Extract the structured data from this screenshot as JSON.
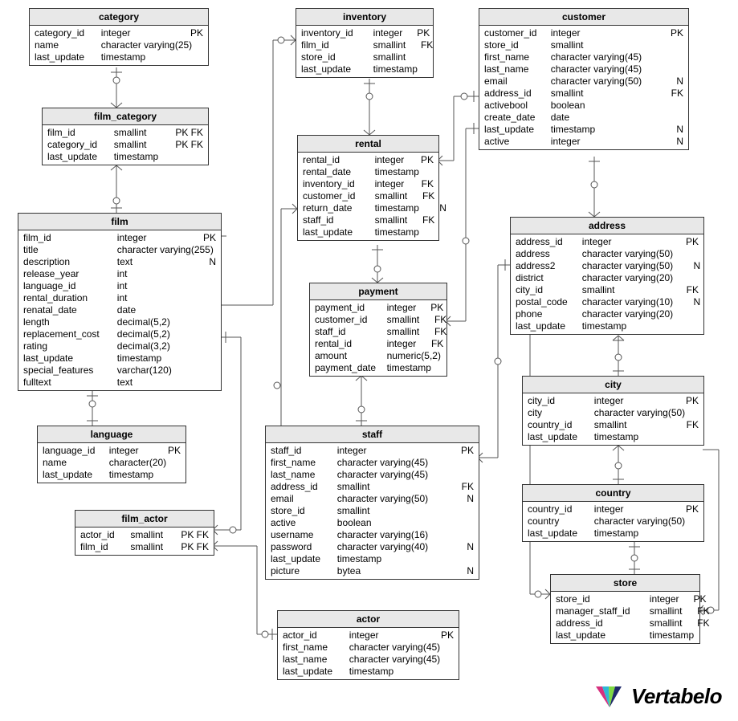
{
  "logo": {
    "text": "Vertabelo"
  },
  "tables": {
    "category": {
      "title": "category",
      "columns": [
        {
          "name": "category_id",
          "type": "integer",
          "key": "PK"
        },
        {
          "name": "name",
          "type": "character varying(25)",
          "key": ""
        },
        {
          "name": "last_update",
          "type": "timestamp",
          "key": ""
        }
      ]
    },
    "film_category": {
      "title": "film_category",
      "columns": [
        {
          "name": "film_id",
          "type": "smallint",
          "key": "PK FK"
        },
        {
          "name": "category_id",
          "type": "smallint",
          "key": "PK FK"
        },
        {
          "name": "last_update",
          "type": "timestamp",
          "key": ""
        }
      ]
    },
    "film": {
      "title": "film",
      "columns": [
        {
          "name": "film_id",
          "type": "integer",
          "key": "PK"
        },
        {
          "name": "title",
          "type": "character varying(255)",
          "key": ""
        },
        {
          "name": "description",
          "type": "text",
          "key": "N"
        },
        {
          "name": "release_year",
          "type": "int",
          "key": ""
        },
        {
          "name": "language_id",
          "type": "int",
          "key": ""
        },
        {
          "name": "rental_duration",
          "type": "int",
          "key": ""
        },
        {
          "name": "renatal_date",
          "type": "date",
          "key": ""
        },
        {
          "name": "length",
          "type": "decimal(5,2)",
          "key": ""
        },
        {
          "name": "replacement_cost",
          "type": "decimal(5,2)",
          "key": ""
        },
        {
          "name": "rating",
          "type": "decimal(3,2)",
          "key": ""
        },
        {
          "name": "last_update",
          "type": "timestamp",
          "key": ""
        },
        {
          "name": "special_features",
          "type": "varchar(120)",
          "key": ""
        },
        {
          "name": "fulltext",
          "type": "text",
          "key": ""
        }
      ]
    },
    "language": {
      "title": "language",
      "columns": [
        {
          "name": "language_id",
          "type": "integer",
          "key": "PK"
        },
        {
          "name": "name",
          "type": "character(20)",
          "key": ""
        },
        {
          "name": "last_update",
          "type": "timestamp",
          "key": ""
        }
      ]
    },
    "film_actor": {
      "title": "film_actor",
      "columns": [
        {
          "name": "actor_id",
          "type": "smallint",
          "key": "PK FK"
        },
        {
          "name": "film_id",
          "type": "smallint",
          "key": "PK FK"
        }
      ]
    },
    "inventory": {
      "title": "inventory",
      "columns": [
        {
          "name": "inventory_id",
          "type": "integer",
          "key": "PK"
        },
        {
          "name": "film_id",
          "type": "smallint",
          "key": "FK"
        },
        {
          "name": "store_id",
          "type": "smallint",
          "key": ""
        },
        {
          "name": "last_update",
          "type": "timestamp",
          "key": ""
        }
      ]
    },
    "rental": {
      "title": "rental",
      "columns": [
        {
          "name": "rental_id",
          "type": "integer",
          "key": "PK"
        },
        {
          "name": "rental_date",
          "type": "timestamp",
          "key": ""
        },
        {
          "name": "inventory_id",
          "type": "integer",
          "key": "FK"
        },
        {
          "name": "customer_id",
          "type": "smallint",
          "key": "FK"
        },
        {
          "name": "return_date",
          "type": "timestamp",
          "key": "N"
        },
        {
          "name": "staff_id",
          "type": "smallint",
          "key": "FK"
        },
        {
          "name": "last_update",
          "type": "timestamp",
          "key": ""
        }
      ]
    },
    "payment": {
      "title": "payment",
      "columns": [
        {
          "name": "payment_id",
          "type": "integer",
          "key": "PK"
        },
        {
          "name": "customer_id",
          "type": "smallint",
          "key": "FK"
        },
        {
          "name": "staff_id",
          "type": "smallint",
          "key": "FK"
        },
        {
          "name": "rental_id",
          "type": "integer",
          "key": "FK"
        },
        {
          "name": "amount",
          "type": "numeric(5,2)",
          "key": ""
        },
        {
          "name": "payment_date",
          "type": "timestamp",
          "key": ""
        }
      ]
    },
    "staff": {
      "title": "staff",
      "columns": [
        {
          "name": "staff_id",
          "type": "integer",
          "key": "PK"
        },
        {
          "name": "first_name",
          "type": "character varying(45)",
          "key": ""
        },
        {
          "name": "last_name",
          "type": "character varying(45)",
          "key": ""
        },
        {
          "name": "address_id",
          "type": "smallint",
          "key": "FK"
        },
        {
          "name": "email",
          "type": "character varying(50)",
          "key": "N"
        },
        {
          "name": "store_id",
          "type": "smallint",
          "key": ""
        },
        {
          "name": "active",
          "type": "boolean",
          "key": ""
        },
        {
          "name": "username",
          "type": "character varying(16)",
          "key": ""
        },
        {
          "name": "password",
          "type": "character varying(40)",
          "key": "N"
        },
        {
          "name": "last_update",
          "type": "timestamp",
          "key": ""
        },
        {
          "name": "picture",
          "type": "bytea",
          "key": "N"
        }
      ]
    },
    "actor": {
      "title": "actor",
      "columns": [
        {
          "name": "actor_id",
          "type": "integer",
          "key": "PK"
        },
        {
          "name": "first_name",
          "type": "character varying(45)",
          "key": ""
        },
        {
          "name": "last_name",
          "type": "character varying(45)",
          "key": ""
        },
        {
          "name": "last_update",
          "type": "timestamp",
          "key": ""
        }
      ]
    },
    "customer": {
      "title": "customer",
      "columns": [
        {
          "name": "customer_id",
          "type": "integer",
          "key": "PK"
        },
        {
          "name": "store_id",
          "type": "smallint",
          "key": ""
        },
        {
          "name": "first_name",
          "type": "character varying(45)",
          "key": ""
        },
        {
          "name": "last_name",
          "type": "character varying(45)",
          "key": ""
        },
        {
          "name": "email",
          "type": "character varying(50)",
          "key": "N"
        },
        {
          "name": "address_id",
          "type": "smallint",
          "key": "FK"
        },
        {
          "name": "activebool",
          "type": "boolean",
          "key": ""
        },
        {
          "name": "create_date",
          "type": "date",
          "key": ""
        },
        {
          "name": "last_update",
          "type": "timestamp",
          "key": "N"
        },
        {
          "name": "active",
          "type": "integer",
          "key": "N"
        }
      ]
    },
    "address": {
      "title": "address",
      "columns": [
        {
          "name": "address_id",
          "type": "integer",
          "key": "PK"
        },
        {
          "name": "address",
          "type": "character varying(50)",
          "key": ""
        },
        {
          "name": "address2",
          "type": "character varying(50)",
          "key": "N"
        },
        {
          "name": "district",
          "type": "character varying(20)",
          "key": ""
        },
        {
          "name": "city_id",
          "type": "smallint",
          "key": "FK"
        },
        {
          "name": "postal_code",
          "type": "character varying(10)",
          "key": "N"
        },
        {
          "name": "phone",
          "type": "character varying(20)",
          "key": ""
        },
        {
          "name": "last_update",
          "type": "timestamp",
          "key": ""
        }
      ]
    },
    "city": {
      "title": "city",
      "columns": [
        {
          "name": "city_id",
          "type": "integer",
          "key": "PK"
        },
        {
          "name": "city",
          "type": "character varying(50)",
          "key": ""
        },
        {
          "name": "country_id",
          "type": "smallint",
          "key": "FK"
        },
        {
          "name": "last_update",
          "type": "timestamp",
          "key": ""
        }
      ]
    },
    "country": {
      "title": "country",
      "columns": [
        {
          "name": "country_id",
          "type": "integer",
          "key": "PK"
        },
        {
          "name": "country",
          "type": "character varying(50)",
          "key": ""
        },
        {
          "name": "last_update",
          "type": "timestamp",
          "key": ""
        }
      ]
    },
    "store": {
      "title": "store",
      "columns": [
        {
          "name": "store_id",
          "type": "integer",
          "key": "PK"
        },
        {
          "name": "manager_staff_id",
          "type": "smallint",
          "key": "FK"
        },
        {
          "name": "address_id",
          "type": "smallint",
          "key": "FK"
        },
        {
          "name": "last_update",
          "type": "timestamp",
          "key": ""
        }
      ]
    }
  },
  "chart_data": {
    "type": "erd",
    "entities": [
      "category",
      "film_category",
      "film",
      "language",
      "film_actor",
      "inventory",
      "rental",
      "payment",
      "staff",
      "actor",
      "customer",
      "address",
      "city",
      "country",
      "store"
    ],
    "relationships": [
      {
        "from": "category",
        "to": "film_category",
        "cardinality": "1:N"
      },
      {
        "from": "film_category",
        "to": "film",
        "cardinality": "N:1"
      },
      {
        "from": "film",
        "to": "language",
        "cardinality": "N:1"
      },
      {
        "from": "film",
        "to": "inventory",
        "cardinality": "1:N"
      },
      {
        "from": "film",
        "to": "film_actor",
        "cardinality": "1:N"
      },
      {
        "from": "film_actor",
        "to": "actor",
        "cardinality": "N:1"
      },
      {
        "from": "inventory",
        "to": "rental",
        "cardinality": "1:N"
      },
      {
        "from": "rental",
        "to": "payment",
        "cardinality": "1:N"
      },
      {
        "from": "rental",
        "to": "staff",
        "cardinality": "N:1"
      },
      {
        "from": "rental",
        "to": "customer",
        "cardinality": "N:1"
      },
      {
        "from": "payment",
        "to": "customer",
        "cardinality": "N:1"
      },
      {
        "from": "payment",
        "to": "staff",
        "cardinality": "N:1"
      },
      {
        "from": "staff",
        "to": "address",
        "cardinality": "N:1"
      },
      {
        "from": "customer",
        "to": "address",
        "cardinality": "N:1"
      },
      {
        "from": "address",
        "to": "city",
        "cardinality": "N:1"
      },
      {
        "from": "city",
        "to": "country",
        "cardinality": "N:1"
      },
      {
        "from": "store",
        "to": "staff",
        "cardinality": "N:1"
      },
      {
        "from": "store",
        "to": "address",
        "cardinality": "N:1"
      }
    ]
  }
}
